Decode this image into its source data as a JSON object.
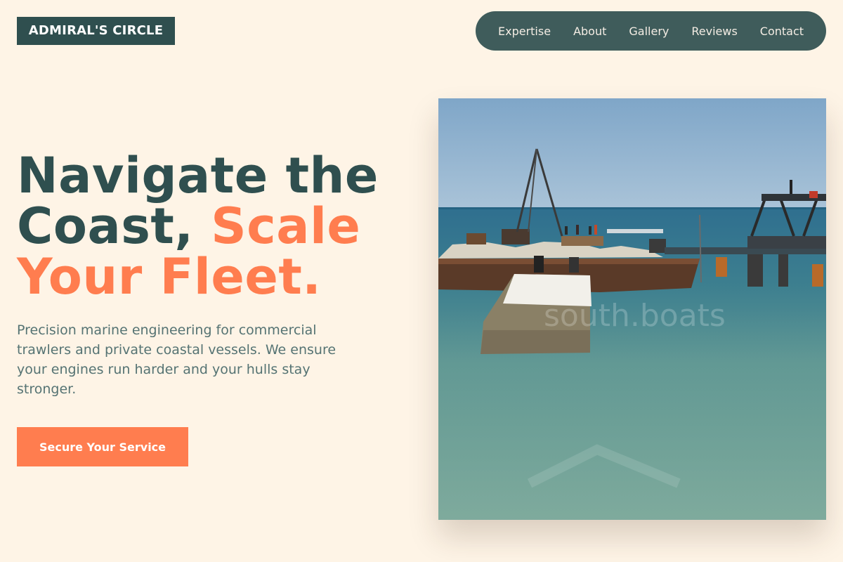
{
  "brand": {
    "logo_text": "ADMIRAL'S CIRCLE"
  },
  "nav": {
    "items": [
      {
        "label": "Expertise"
      },
      {
        "label": "About"
      },
      {
        "label": "Gallery"
      },
      {
        "label": "Reviews"
      },
      {
        "label": "Contact"
      }
    ]
  },
  "hero": {
    "headline": {
      "line1": "Navigate the",
      "line2_plain": "Coast, ",
      "line2_accent": "Scale",
      "line3_accent": "Your Fleet."
    },
    "description": "Precision marine engineering for commercial trawlers and private coastal vessels. We ensure your engines run harder and your hulls stay stronger.",
    "cta_label": "Secure Your Service",
    "image": {
      "watermark_text": "south.boats"
    }
  },
  "colors": {
    "background": "#fef4e6",
    "primary_dark": "#2f4f4f",
    "accent": "#ff7d4f",
    "nav_bg": "#3f5c5b",
    "body_text": "#557373"
  }
}
